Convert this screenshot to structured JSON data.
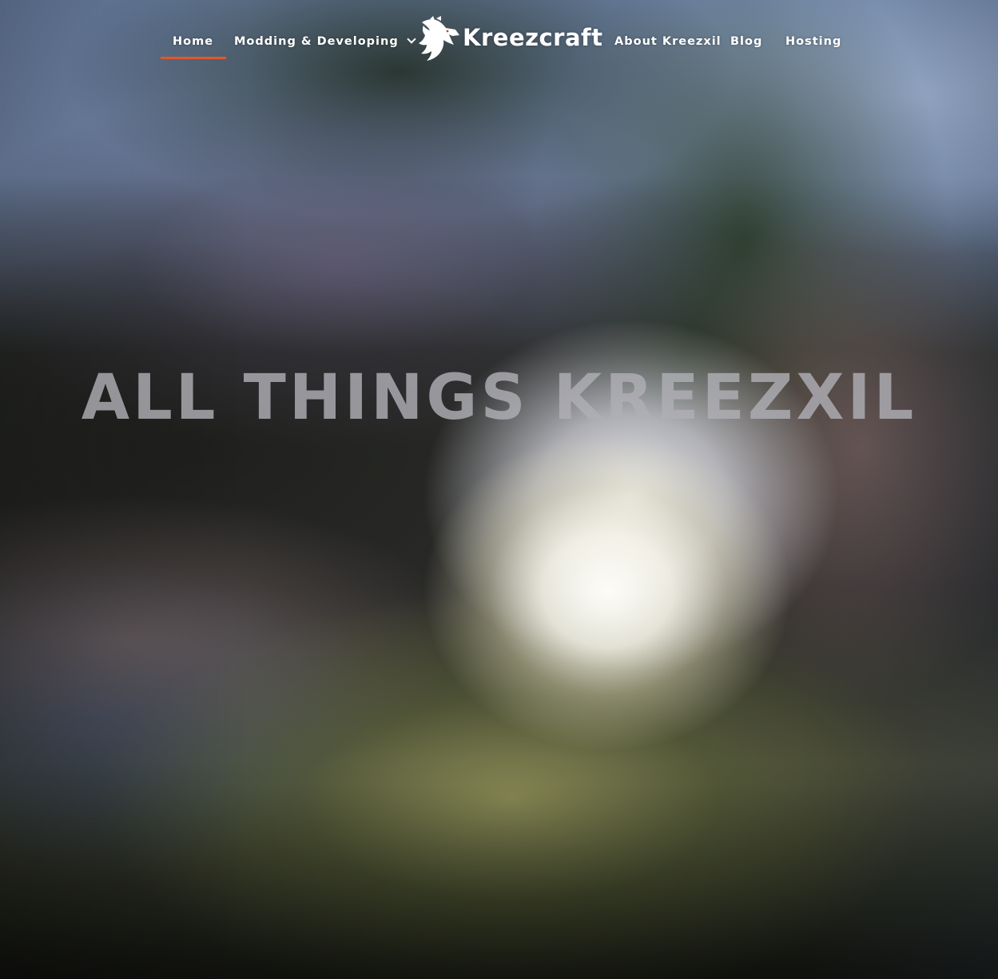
{
  "nav": {
    "items_left": [
      {
        "label": "Home",
        "active": true
      },
      {
        "label": "Modding & Developing",
        "has_dropdown": true
      }
    ],
    "brand": {
      "name": "Kreezcraft",
      "logo_icon": "dragon-head-icon"
    },
    "items_right": [
      {
        "label": "About Kreezxil"
      },
      {
        "label": "Blog"
      },
      {
        "label": "Hosting"
      }
    ],
    "accent_color": "#e2572b"
  },
  "hero": {
    "headline": "ALL THINGS KREEZXIL"
  }
}
